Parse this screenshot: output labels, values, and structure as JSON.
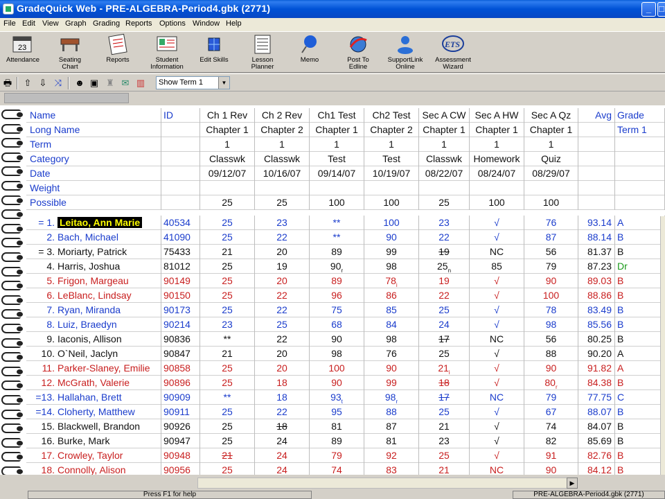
{
  "window": {
    "title": "GradeQuick Web - PRE-ALGEBRA-Period4.gbk (2771)",
    "min_glyph": "_",
    "max_glyph": "□"
  },
  "menu": [
    "File",
    "Edit",
    "View",
    "Graph",
    "Grading",
    "Reports",
    "Options",
    "Window",
    "Help"
  ],
  "toolbar": [
    {
      "label1": "Attendance",
      "label2": "",
      "icon": "calendar-icon"
    },
    {
      "label1": "Seating",
      "label2": "Chart",
      "icon": "desk-icon"
    },
    {
      "label1": "Reports",
      "label2": "",
      "icon": "report-icon"
    },
    {
      "label1": "Student",
      "label2": "Information",
      "icon": "student-card-icon"
    },
    {
      "label1": "Edit Skills",
      "label2": "",
      "icon": "skills-cube-icon"
    },
    {
      "label1": "Lesson",
      "label2": "Planner",
      "icon": "planner-icon"
    },
    {
      "label1": "Memo",
      "label2": "",
      "icon": "pushpin-icon"
    },
    {
      "label1": "Post To",
      "label2": "Edline",
      "icon": "globe-arrow-icon"
    },
    {
      "label1": "SupportLink",
      "label2": "Online",
      "icon": "support-person-icon"
    },
    {
      "label1": "Assessment",
      "label2": "Wizard",
      "icon": "ets-logo-icon"
    }
  ],
  "term_select": "Show Term 1",
  "header_rows": [
    {
      "label": "Name",
      "id": "ID",
      "cols": [
        "Ch 1 Rev",
        "Ch 2 Rev",
        "Ch1 Test",
        "Ch2 Test",
        "Sec A CW",
        "Sec A HW",
        "Sec A Qz"
      ],
      "avg": "Avg",
      "grade": "Grade"
    },
    {
      "label": "Long Name",
      "id": "",
      "cols": [
        "Chapter 1",
        "Chapter 2",
        "Chapter 1",
        "Chapter 2",
        "Chapter 1",
        "Chapter 1",
        "Chapter 1"
      ],
      "avg": "",
      "grade": "Term 1"
    },
    {
      "label": "Term",
      "id": "",
      "cols": [
        "1",
        "1",
        "1",
        "1",
        "1",
        "1",
        "1"
      ],
      "avg": "",
      "grade": ""
    },
    {
      "label": "Category",
      "id": "",
      "cols": [
        "Classwk",
        "Classwk",
        "Test",
        "Test",
        "Classwk",
        "Homework",
        "Quiz"
      ],
      "avg": "",
      "grade": ""
    },
    {
      "label": "Date",
      "id": "",
      "cols": [
        "09/12/07",
        "10/16/07",
        "09/14/07",
        "10/19/07",
        "08/22/07",
        "08/24/07",
        "08/29/07"
      ],
      "avg": "",
      "grade": ""
    },
    {
      "label": "Weight",
      "id": "",
      "cols": [
        "",
        "",
        "",
        "",
        "",
        "",
        ""
      ],
      "avg": "",
      "grade": ""
    },
    {
      "label": "Possible",
      "id": "",
      "cols": [
        "25",
        "25",
        "100",
        "100",
        "25",
        "100",
        "100"
      ],
      "avg": "",
      "grade": ""
    }
  ],
  "students": [
    {
      "num": "= 1.",
      "name": "Leitao, Ann Marie",
      "id": "40534",
      "scores": [
        "25",
        "23",
        "**",
        "100",
        "23",
        "√",
        "76"
      ],
      "avg": "93.14",
      "grade": "A",
      "color": "blue",
      "selected": true
    },
    {
      "num": "2.",
      "name": "Bach, Michael",
      "id": "41090",
      "scores": [
        "25",
        "22",
        "**",
        "90",
        "22",
        "√",
        "87"
      ],
      "avg": "88.14",
      "grade": "B",
      "color": "blue"
    },
    {
      "num": "= 3.",
      "name": "Moriarty, Patrick",
      "id": "75433",
      "scores": [
        "21",
        "20",
        "89",
        "99",
        "19",
        "NC",
        "56"
      ],
      "avg": "81.37",
      "grade": "B",
      "color": "black",
      "strike": [
        4
      ]
    },
    {
      "num": "4.",
      "name": "Harris, Joshua",
      "id": "81012",
      "scores": [
        "25",
        "19",
        "90",
        "98",
        "25",
        "85",
        "79"
      ],
      "avg": "87.23",
      "grade": "Dr",
      "color": "black",
      "subs": {
        "2": "r",
        "4": "n"
      },
      "grade_color": "green"
    },
    {
      "num": "5.",
      "name": "Frigon, Margeau",
      "id": "90149",
      "scores": [
        "25",
        "20",
        "89",
        "78",
        "19",
        "√",
        "90"
      ],
      "avg": "89.03",
      "grade": "B",
      "color": "red",
      "subs": {
        "3": "i"
      }
    },
    {
      "num": "6.",
      "name": "LeBlanc, Lindsay",
      "id": "90150",
      "scores": [
        "25",
        "22",
        "96",
        "86",
        "22",
        "√",
        "100"
      ],
      "avg": "88.86",
      "grade": "B",
      "color": "red"
    },
    {
      "num": "7.",
      "name": "Ryan, Miranda",
      "id": "90173",
      "scores": [
        "25",
        "22",
        "75",
        "85",
        "25",
        "√",
        "78"
      ],
      "avg": "83.49",
      "grade": "B",
      "color": "blue"
    },
    {
      "num": "8.",
      "name": "Luiz, Braedyn",
      "id": "90214",
      "scores": [
        "23",
        "25",
        "68",
        "84",
        "24",
        "√",
        "98"
      ],
      "avg": "85.56",
      "grade": "B",
      "color": "blue"
    },
    {
      "num": "9.",
      "name": "Iaconis, Allison",
      "id": "90836",
      "scores": [
        "**",
        "22",
        "90",
        "98",
        "17",
        "NC",
        "56"
      ],
      "avg": "80.25",
      "grade": "B",
      "color": "black",
      "strike": [
        4
      ]
    },
    {
      "num": "10.",
      "name": "O`Neil, Jaclyn",
      "id": "90847",
      "scores": [
        "21",
        "20",
        "98",
        "76",
        "25",
        "√",
        "88"
      ],
      "avg": "90.20",
      "grade": "A",
      "color": "black"
    },
    {
      "num": "11.",
      "name": "Parker-Slaney, Emilie",
      "id": "90858",
      "scores": [
        "25",
        "20",
        "100",
        "90",
        "21",
        "√",
        "90"
      ],
      "avg": "91.82",
      "grade": "A",
      "color": "red",
      "subs": {
        "4": "i"
      }
    },
    {
      "num": "12.",
      "name": "McGrath, Valerie",
      "id": "90896",
      "scores": [
        "25",
        "18",
        "90",
        "99",
        "18",
        "√",
        "80"
      ],
      "avg": "84.38",
      "grade": "B",
      "color": "red",
      "strike": [
        4
      ],
      "subs": {
        "6": "r"
      }
    },
    {
      "num": "=13.",
      "name": "Hallahan, Brett",
      "id": "90909",
      "scores": [
        "**",
        "18",
        "93",
        "98",
        "17",
        "NC",
        "79"
      ],
      "avg": "77.75",
      "grade": "C",
      "color": "blue",
      "strike": [
        4
      ],
      "subs": {
        "2": "t",
        "3": "r"
      }
    },
    {
      "num": "=14.",
      "name": "Cloherty, Matthew",
      "id": "90911",
      "scores": [
        "25",
        "22",
        "95",
        "88",
        "25",
        "√",
        "67"
      ],
      "avg": "88.07",
      "grade": "B",
      "color": "blue"
    },
    {
      "num": "15.",
      "name": "Blackwell, Brandon",
      "id": "90926",
      "scores": [
        "25",
        "18",
        "81",
        "87",
        "21",
        "√",
        "74"
      ],
      "avg": "84.07",
      "grade": "B",
      "color": "black",
      "strike": [
        1
      ]
    },
    {
      "num": "16.",
      "name": "Burke, Mark",
      "id": "90947",
      "scores": [
        "25",
        "24",
        "89",
        "81",
        "23",
        "√",
        "82"
      ],
      "avg": "85.69",
      "grade": "B",
      "color": "black"
    },
    {
      "num": "17.",
      "name": "Crowley, Taylor",
      "id": "90948",
      "scores": [
        "21",
        "24",
        "79",
        "92",
        "25",
        "√",
        "91"
      ],
      "avg": "82.76",
      "grade": "B",
      "color": "red",
      "strike": [
        0
      ]
    },
    {
      "num": "18.",
      "name": "Connolly, Alison",
      "id": "90956",
      "scores": [
        "25",
        "24",
        "74",
        "83",
        "21",
        "NC",
        "90"
      ],
      "avg": "84.12",
      "grade": "B",
      "color": "red"
    }
  ],
  "status": {
    "help": "Press F1 for help",
    "file": "PRE-ALGEBRA-Period4.gbk (2771)"
  }
}
